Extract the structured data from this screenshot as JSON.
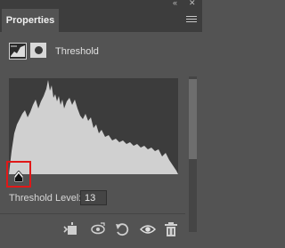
{
  "panel": {
    "tab_label": "Properties",
    "collapse_glyph": "«",
    "close_glyph": "✕"
  },
  "adjustment": {
    "title": "Threshold",
    "icons": [
      "adjustment-layer-icon",
      "mask-icon"
    ]
  },
  "histogram": {
    "fill_color": "#d0d0d0",
    "background": "#3c3c3c"
  },
  "threshold": {
    "label": "Threshold Level:",
    "value": "13"
  },
  "bottom_toolbar": {
    "icons": [
      "clip-to-layer-icon",
      "view-previous-state-icon",
      "reset-icon",
      "visibility-eye-icon",
      "delete-trash-icon"
    ]
  },
  "colors": {
    "highlight_box": "#e01818",
    "panel_bg": "#535353",
    "tab_bar_bg": "#3d3d3d"
  }
}
